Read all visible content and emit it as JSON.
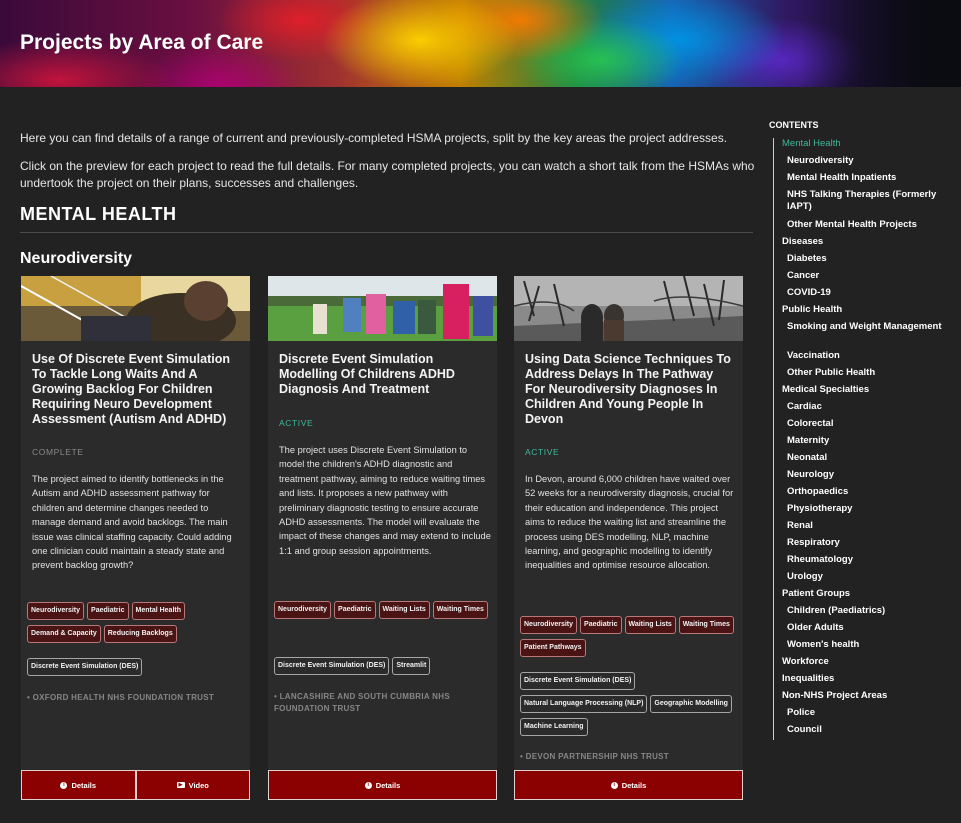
{
  "page": {
    "title": "Projects by Area of Care",
    "intro": [
      "Here you can find details of a range of current and previously-completed HSMA projects, split by the key areas the project addresses.",
      "Click on the preview for each project to read the full details. For many completed projects, you can watch a short talk from the HSMAs who undertook the project on their plans, successes and challenges."
    ],
    "section": "MENTAL HEALTH",
    "subsection": "Neurodiversity"
  },
  "cards": [
    {
      "title": "Use Of Discrete Event Simulation To Tackle Long Waits And A Growing Backlog For Children Requiring Neuro Development Assessment (Autism And ADHD)",
      "status": "COMPLETE",
      "description": "The project aimed to identify bottlenecks in the Autism and ADHD assessment pathway for children and determine changes needed to manage demand and avoid backlogs. The main issue was clinical staffing capacity. Could adding one clinician could maintain a steady state and prevent backlog growth?",
      "area_tags": [
        "Neurodiversity",
        "Paediatric",
        "Mental Health",
        "Demand & Capacity",
        "Reducing Backlogs"
      ],
      "method_tags": [
        "Discrete Event Simulation (DES)"
      ],
      "org": "• OXFORD HEALTH NHS FOUNDATION TRUST",
      "buttons": [
        "Details",
        "Video"
      ]
    },
    {
      "title": "Discrete Event Simulation Modelling Of Childrens ADHD Diagnosis And Treatment",
      "status": "ACTIVE",
      "description": "The project uses Discrete Event Simulation to model the children's ADHD diagnostic and treatment pathway, aiming to reduce waiting times and lists. It proposes a new pathway with preliminary diagnostic testing to ensure accurate ADHD assessments. The model will evaluate the impact of these changes and may extend to include 1:1 and group session appointments.",
      "area_tags": [
        "Neurodiversity",
        "Paediatric",
        "Waiting Lists",
        "Waiting Times"
      ],
      "method_tags": [
        "Discrete Event Simulation (DES)",
        "Streamlit"
      ],
      "org": "• LANCASHIRE AND SOUTH CUMBRIA NHS FOUNDATION TRUST",
      "buttons": [
        "Details"
      ]
    },
    {
      "title": "Using Data Science Techniques To Address Delays In The Pathway For Neurodiversity Diagnoses In Children And Young People In Devon",
      "status": "ACTIVE",
      "description": "In Devon, around 6,000 children have waited over 52 weeks for a neurodiversity diagnosis, crucial for their education and independence. This project aims to reduce the waiting list and streamline the process using DES modelling, NLP, machine learning, and geographic modelling to identify inequalities and optimise resource allocation.",
      "area_tags": [
        "Neurodiversity",
        "Paediatric",
        "Waiting Lists",
        "Waiting Times",
        "Patient Pathways"
      ],
      "method_tags": [
        "Discrete Event Simulation (DES)",
        "Natural Language Processing (NLP)",
        "Geographic Modelling",
        "Machine Learning"
      ],
      "org": "• DEVON PARTNERSHIP NHS TRUST",
      "buttons": [
        "Details"
      ]
    }
  ],
  "toc": {
    "heading": "CONTENTS",
    "items": [
      {
        "label": "Mental Health",
        "level": 1,
        "active": true
      },
      {
        "label": "Neurodiversity",
        "level": 2
      },
      {
        "label": "Mental Health Inpatients",
        "level": 2
      },
      {
        "label": "NHS Talking Therapies (Formerly IAPT)",
        "level": 2
      },
      {
        "label": "Other Mental Health Projects",
        "level": 2
      },
      {
        "label": "Diseases",
        "level": 1
      },
      {
        "label": "Diabetes",
        "level": 2
      },
      {
        "label": "Cancer",
        "level": 2
      },
      {
        "label": "COVID-19",
        "level": 2
      },
      {
        "label": "Public Health",
        "level": 1
      },
      {
        "label": "Smoking and Weight Management",
        "level": 2
      },
      {
        "label": "Vaccination",
        "level": 2
      },
      {
        "label": "Other Public Health",
        "level": 2
      },
      {
        "label": "Medical Specialties",
        "level": 1
      },
      {
        "label": "Cardiac",
        "level": 2
      },
      {
        "label": "Colorectal",
        "level": 2
      },
      {
        "label": "Maternity",
        "level": 2
      },
      {
        "label": "Neonatal",
        "level": 2
      },
      {
        "label": "Neurology",
        "level": 2
      },
      {
        "label": "Orthopaedics",
        "level": 2
      },
      {
        "label": "Physiotherapy",
        "level": 2
      },
      {
        "label": "Renal",
        "level": 2
      },
      {
        "label": "Respiratory",
        "level": 2
      },
      {
        "label": "Rheumatology",
        "level": 2
      },
      {
        "label": "Urology",
        "level": 2
      },
      {
        "label": "Patient Groups",
        "level": 1
      },
      {
        "label": "Children (Paediatrics)",
        "level": 2
      },
      {
        "label": "Older Adults",
        "level": 2
      },
      {
        "label": "Women's health",
        "level": 2
      },
      {
        "label": "Workforce",
        "level": 1
      },
      {
        "label": "Inequalities",
        "level": 1
      },
      {
        "label": "Non-NHS Project Areas",
        "level": 1
      },
      {
        "label": "Police",
        "level": 2
      },
      {
        "label": "Council",
        "level": 2
      }
    ]
  },
  "colors": {
    "background": "#222222",
    "card": "#2b2b2b",
    "button": "#8b0000",
    "active_status": "#3fb89a",
    "complete_status": "#8a8a8a",
    "toc_active": "#3fb89a"
  }
}
